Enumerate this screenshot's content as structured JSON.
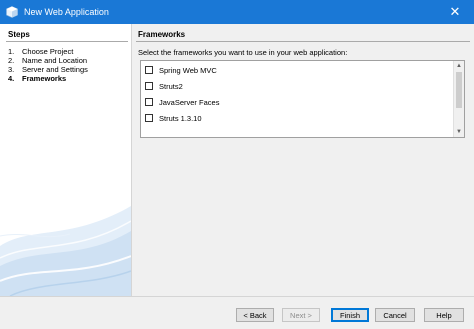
{
  "window": {
    "title": "New Web Application",
    "close_symbol": "✕"
  },
  "steps": {
    "heading": "Steps",
    "items": [
      {
        "num": "1.",
        "label": "Choose Project"
      },
      {
        "num": "2.",
        "label": "Name and Location"
      },
      {
        "num": "3.",
        "label": "Server and Settings"
      },
      {
        "num": "4.",
        "label": "Frameworks"
      }
    ]
  },
  "frameworks": {
    "heading": "Frameworks",
    "description": "Select the frameworks you want to use in your web application:",
    "items": [
      {
        "label": "Spring Web MVC",
        "checked": false
      },
      {
        "label": "Struts2",
        "checked": false
      },
      {
        "label": "JavaServer Faces",
        "checked": false
      },
      {
        "label": "Struts 1.3.10",
        "checked": false
      }
    ]
  },
  "buttons": {
    "back": "< Back",
    "next": "Next >",
    "finish": "Finish",
    "cancel": "Cancel",
    "help": "Help"
  },
  "colors": {
    "titlebar": "#1a78d6",
    "accent": "#0078d7"
  }
}
